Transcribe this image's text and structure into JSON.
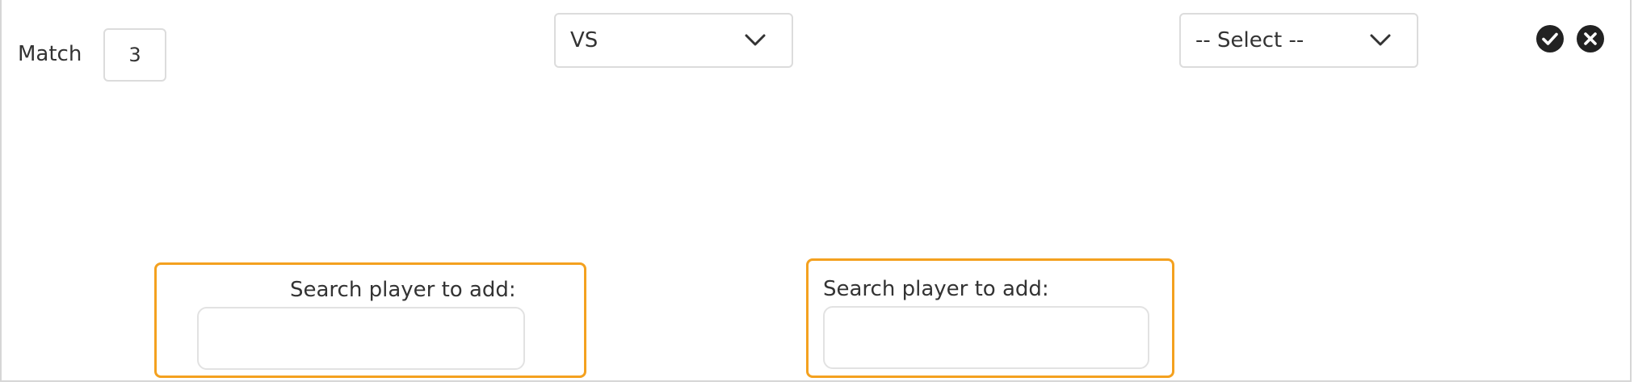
{
  "match": {
    "label": "Match",
    "number": "3"
  },
  "vs_select": {
    "value": "VS",
    "icon": "chevron-down-icon"
  },
  "team_select": {
    "value": "-- Select --",
    "icon": "chevron-down-icon"
  },
  "actions": {
    "confirm_icon": "check-circle-icon",
    "cancel_icon": "close-circle-icon"
  },
  "search_left": {
    "label": "Search player to add:",
    "value": "",
    "placeholder": ""
  },
  "search_right": {
    "label": "Search player to add:",
    "value": "",
    "placeholder": ""
  },
  "colors": {
    "highlight_border": "#f4a11f",
    "input_border": "#dcdcdc",
    "icon_fill": "#222222"
  }
}
